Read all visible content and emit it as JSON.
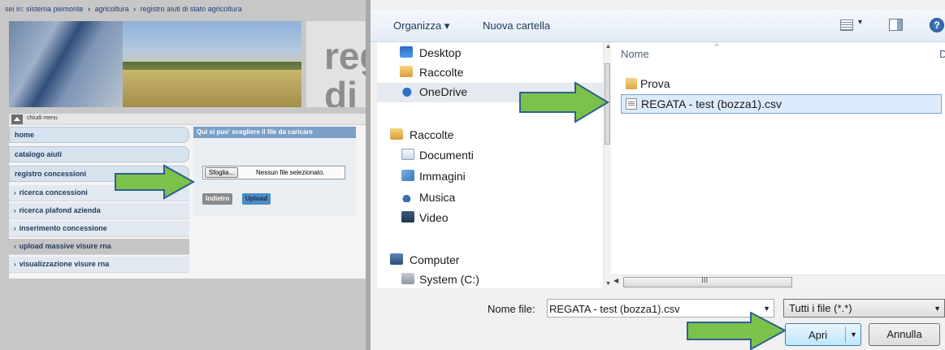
{
  "web": {
    "breadcrumb": {
      "label": "sei in:",
      "items": [
        "sistema piemonte",
        "agricoltura",
        "registro aiuti di stato agricoltura"
      ]
    },
    "title_fragment_1": "reg",
    "title_fragment_2": "di s",
    "close_menu": "chiudi menu",
    "nav": [
      {
        "label": "home"
      },
      {
        "label": "catalogo aiuti"
      },
      {
        "label": "registro concessioni"
      },
      {
        "label": "ricerca concessioni"
      },
      {
        "label": "ricerca plafond azienda"
      },
      {
        "label": "inserimento concessione"
      },
      {
        "label": "upload massive visure rna"
      },
      {
        "label": "visualizzazione visure rna"
      }
    ],
    "panel": {
      "header": "Qui si puo' scegliere il file da caricare",
      "browse_label": "Sfoglia...",
      "file_status": "Nessun file selezionato.",
      "back_label": "Indietro",
      "upload_label": "Upload"
    }
  },
  "dialog": {
    "toolbar": {
      "organize": "Organizza ▾",
      "new_folder": "Nuova cartella"
    },
    "nav": [
      {
        "label": "Desktop",
        "icon": "desktop-icon"
      },
      {
        "label": "Raccolte",
        "icon": "libraries-icon"
      },
      {
        "label": "OneDrive",
        "icon": "onedrive-icon"
      },
      {
        "label": "Raccolte",
        "icon": "libraries-icon"
      },
      {
        "label": "Documenti",
        "icon": "documents-icon"
      },
      {
        "label": "Immagini",
        "icon": "pictures-icon"
      },
      {
        "label": "Musica",
        "icon": "music-icon"
      },
      {
        "label": "Video",
        "icon": "video-icon"
      },
      {
        "label": "Computer",
        "icon": "computer-icon"
      },
      {
        "label": "System (C:)",
        "icon": "drive-icon"
      }
    ],
    "list": {
      "column_name": "Nome",
      "column_next": "D",
      "files": [
        {
          "name": "Prova",
          "icon": "folder-icon"
        },
        {
          "name": "REGATA - test (bozza1).csv",
          "icon": "csv-file-icon"
        }
      ]
    },
    "filename_label": "Nome file:",
    "filename_value": "REGATA - test (bozza1).csv",
    "filetype_value": "Tutti i file (*.*)",
    "open_label": "Apri",
    "cancel_label": "Annulla",
    "help_glyph": "?"
  },
  "colors": {
    "arrow_green": "#7cc24a",
    "arrow_outline": "#2f5f8f",
    "selection": "#dcebfc"
  }
}
